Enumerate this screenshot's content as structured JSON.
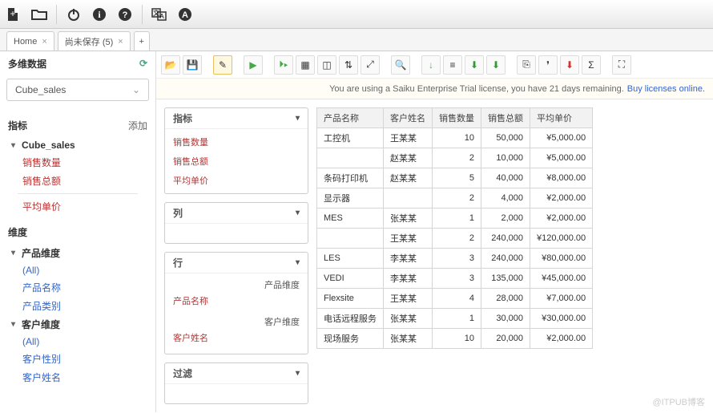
{
  "tabs": {
    "home": "Home",
    "unsaved": "尚未保存 (5)"
  },
  "sidebar": {
    "title": "多维数据",
    "cube": "Cube_sales",
    "metrics_label": "指标",
    "add_label": "添加",
    "cube_name": "Cube_sales",
    "m1": "销售数量",
    "m2": "销售总额",
    "m3": "平均单价",
    "dim_label": "维度",
    "d1": "产品维度",
    "d1_all": "(All)",
    "d1_a": "产品名称",
    "d1_b": "产品类别",
    "d2": "客户维度",
    "d2_all": "(All)",
    "d2_a": "客户性别",
    "d2_b": "客户姓名"
  },
  "notice": {
    "text": "You are using a Saiku Enterprise Trial license, you have 21 days remaining.",
    "link": "Buy licenses online."
  },
  "panels": {
    "metrics": "指标",
    "cols": "列",
    "rows": "行",
    "filter": "过滤",
    "axis_m1": "销售数量",
    "axis_m2": "销售总额",
    "axis_m3": "平均单价",
    "row_dim1": "产品维度",
    "row_val1": "产品名称",
    "row_dim2": "客户维度",
    "row_val2": "客户姓名"
  },
  "grid": {
    "h1": "产品名称",
    "h2": "客户姓名",
    "h3": "销售数量",
    "h4": "销售总额",
    "h5": "平均单价",
    "rows": [
      [
        "工控机",
        "王某某",
        "10",
        "50,000",
        "¥5,000.00"
      ],
      [
        "",
        "赵某某",
        "2",
        "10,000",
        "¥5,000.00"
      ],
      [
        "条码打印机",
        "赵某某",
        "5",
        "40,000",
        "¥8,000.00"
      ],
      [
        "显示器",
        "",
        "2",
        "4,000",
        "¥2,000.00"
      ],
      [
        "MES",
        "张某某",
        "1",
        "2,000",
        "¥2,000.00"
      ],
      [
        "",
        "王某某",
        "2",
        "240,000",
        "¥120,000.00"
      ],
      [
        "LES",
        "李某某",
        "3",
        "240,000",
        "¥80,000.00"
      ],
      [
        "VEDI",
        "李某某",
        "3",
        "135,000",
        "¥45,000.00"
      ],
      [
        "Flexsite",
        "王某某",
        "4",
        "28,000",
        "¥7,000.00"
      ],
      [
        "电话远程服务",
        "张某某",
        "1",
        "30,000",
        "¥30,000.00"
      ],
      [
        "现场服务",
        "张某某",
        "10",
        "20,000",
        "¥2,000.00"
      ]
    ]
  },
  "watermark": "@ITPUB博客"
}
